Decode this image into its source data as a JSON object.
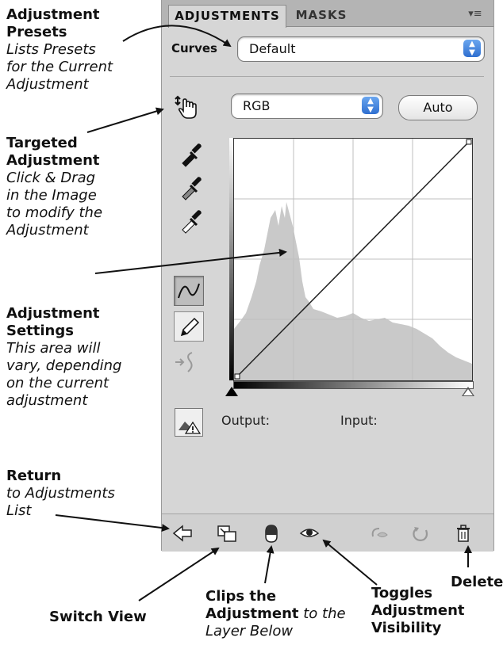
{
  "panel": {
    "tabs": [
      {
        "label": "ADJUSTMENTS"
      },
      {
        "label": "MASKS"
      }
    ],
    "menu_icon": "panel-menu-icon",
    "adjustment_label": "Curves",
    "preset": {
      "value": "Default"
    },
    "channel": {
      "value": "RGB"
    },
    "auto_label": "Auto",
    "output_label": "Output:",
    "input_label": "Input:"
  },
  "annotations": {
    "presets": {
      "title1": "Adjustment",
      "title2": "Presets",
      "body": [
        "Lists Presets",
        "for the Current",
        "Adjustment"
      ]
    },
    "targeted": {
      "title1": "Targeted",
      "title2": "Adjustment",
      "body": [
        "Click & Drag",
        "in the Image",
        "to modify the",
        "Adjustment"
      ]
    },
    "settings": {
      "title1": "Adjustment",
      "title2": "Settings",
      "body": [
        "This area will",
        "vary, depending",
        "on the current",
        "adjustment"
      ]
    },
    "return": {
      "title1": "Return",
      "body": [
        "to Adjustments",
        "List"
      ]
    },
    "switch_view": "Switch View",
    "clips": {
      "l1": "Clips the",
      "l2b": "Adjustment",
      "l2i": " to the",
      "l3": "Layer Below"
    },
    "toggles": {
      "l1": "Toggles",
      "l2": "Adjustment",
      "l3": "Visibility"
    },
    "delete": "Delete"
  },
  "colors": {
    "panel_bg": "#d6d6d6",
    "accent_blue": "#3d7fe0"
  }
}
